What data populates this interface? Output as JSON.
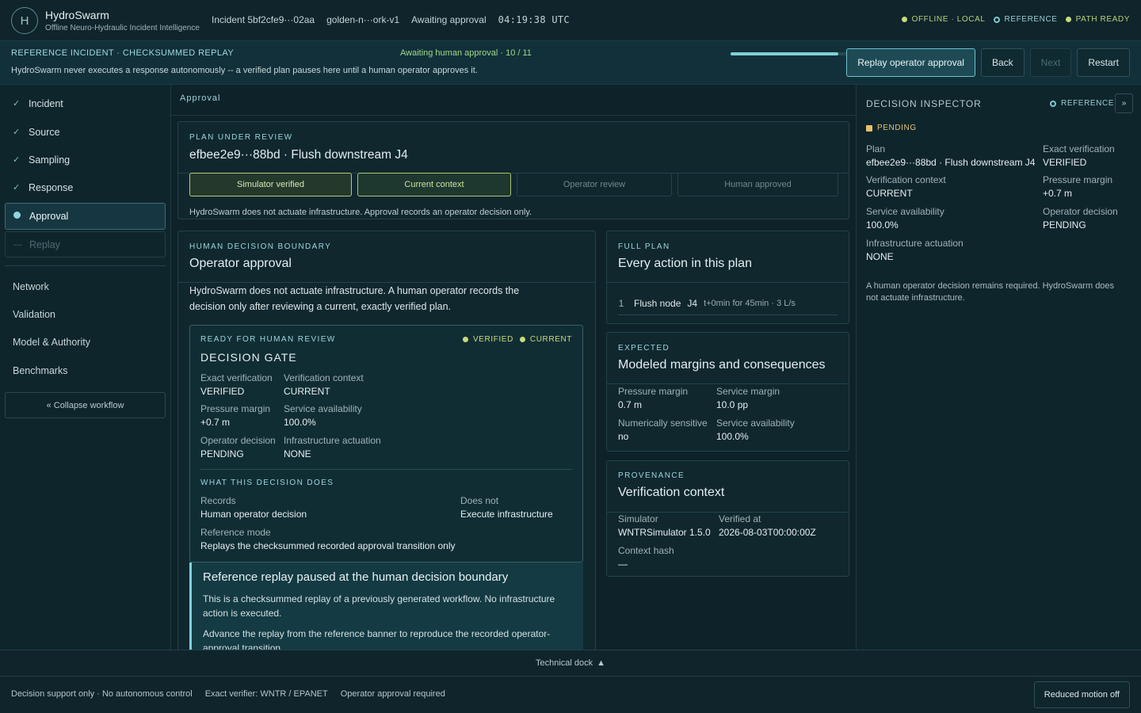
{
  "app": {
    "logo_letter": "H",
    "name": "HydroSwarm",
    "subtitle": "Offline Neuro-Hydraulic Incident Intelligence"
  },
  "topbar": {
    "incident": "Incident 5bf2cfe9···02aa",
    "network": "golden-n···ork-v1",
    "state": "Awaiting approval",
    "clock": "04:19:38 UTC",
    "status": {
      "offline": "OFFLINE · LOCAL",
      "reference": "REFERENCE",
      "path": "PATH READY"
    },
    "colors": {
      "ready": "#c7dc7c",
      "reference": "#7fc8d0"
    }
  },
  "banner": {
    "title": "REFERENCE INCIDENT · CHECKSUMMED REPLAY",
    "progress_label": "Awaiting human approval · 10 / 11",
    "progress_step": 10,
    "progress_total": 11,
    "description": "HydroSwarm never executes a response autonomously -- a verified plan pauses here until a human operator approves it.",
    "buttons": {
      "replay": "Replay operator approval",
      "back": "Back",
      "next": "Next",
      "restart": "Restart"
    }
  },
  "sidebar": {
    "steps": [
      {
        "label": "Incident",
        "state": "done"
      },
      {
        "label": "Source",
        "state": "done"
      },
      {
        "label": "Sampling",
        "state": "done"
      },
      {
        "label": "Response",
        "state": "done"
      },
      {
        "label": "Approval",
        "state": "active"
      },
      {
        "label": "Replay",
        "state": "locked"
      }
    ],
    "done_mark": "✓",
    "locked_mark": "—",
    "links": [
      "Network",
      "Validation",
      "Model & Authority",
      "Benchmarks"
    ],
    "collapse": "« Collapse workflow"
  },
  "main": {
    "breadcrumb": "Approval",
    "plan": {
      "kicker": "PLAN UNDER REVIEW",
      "title": "efbee2e9···88bd · Flush downstream J4",
      "gates": [
        {
          "label": "Simulator verified",
          "state": "ok"
        },
        {
          "label": "Current context",
          "state": "ok"
        },
        {
          "label": "Operator review",
          "state": "pending"
        },
        {
          "label": "Human approved",
          "state": "pending"
        }
      ],
      "note": "HydroSwarm does not actuate infrastructure. Approval records an operator decision only."
    },
    "approval": {
      "kicker": "HUMAN DECISION BOUNDARY",
      "title": "Operator approval",
      "intro": "HydroSwarm does not actuate infrastructure. A human operator records the decision only after reviewing a current, exactly verified plan.",
      "gate": {
        "kicker": "READY FOR HUMAN REVIEW",
        "badge_verified": "VERIFIED",
        "badge_current": "CURRENT",
        "title": "DECISION GATE",
        "fields": [
          {
            "label": "Exact verification",
            "value": "VERIFIED"
          },
          {
            "label": "Verification context",
            "value": "CURRENT"
          },
          {
            "label": "Pressure margin",
            "value": "+0.7 m"
          },
          {
            "label": "Service availability",
            "value": "100.0%"
          },
          {
            "label": "Operator decision",
            "value": "PENDING"
          },
          {
            "label": "Infrastructure actuation",
            "value": "NONE"
          }
        ],
        "does_kicker": "WHAT THIS DECISION DOES",
        "records_label": "Records",
        "records_value": "Human operator decision",
        "does_not_label": "Does not",
        "does_not_value": "Execute infrastructure",
        "mode_label": "Reference mode",
        "mode_value": "Replays the checksummed recorded approval transition only"
      },
      "notice": {
        "title": "Reference replay paused at the human decision boundary",
        "p1": "This is a checksummed replay of a previously generated workflow. No infrastructure action is executed.",
        "p2": "Advance the replay from the reference banner to reproduce the recorded operator-approval transition."
      }
    },
    "full_plan": {
      "kicker": "FULL PLAN",
      "title": "Every action in this plan",
      "actions": [
        {
          "index": "1",
          "action": "Flush node",
          "node": "J4",
          "detail": "t+0min for 45min · 3 L/s"
        }
      ]
    },
    "expected": {
      "kicker": "EXPECTED",
      "title": "Modeled margins and consequences",
      "fields": [
        {
          "label": "Pressure margin",
          "value": "0.7 m"
        },
        {
          "label": "Service margin",
          "value": "10.0 pp"
        },
        {
          "label": "Numerically sensitive",
          "value": "no"
        },
        {
          "label": "Service availability",
          "value": "100.0%"
        }
      ]
    },
    "provenance": {
      "kicker": "PROVENANCE",
      "title": "Verification context",
      "fields": [
        {
          "label": "Simulator",
          "value": "WNTRSimulator 1.5.0"
        },
        {
          "label": "Verified at",
          "value": "2026-08-03T00:00:00Z"
        },
        {
          "label": "Context hash",
          "value": "—"
        }
      ]
    }
  },
  "inspector": {
    "title": "DECISION INSPECTOR",
    "reference": "REFERENCE",
    "expand_icon": "»",
    "status": "PENDING",
    "fields": [
      {
        "label": "Plan",
        "value": "efbee2e9···88bd · Flush downstream J4"
      },
      {
        "label": "Exact verification",
        "value": "VERIFIED"
      },
      {
        "label": "Verification context",
        "value": "CURRENT"
      },
      {
        "label": "Pressure margin",
        "value": "+0.7 m"
      },
      {
        "label": "Service availability",
        "value": "100.0%"
      },
      {
        "label": "Operator decision",
        "value": "PENDING"
      },
      {
        "label": "Infrastructure actuation",
        "value": "NONE"
      }
    ],
    "note": "A human operator decision remains required. HydroSwarm does not actuate infrastructure."
  },
  "dock": {
    "label": "Technical dock",
    "icon": "▲"
  },
  "footer": {
    "items": [
      "Decision support only · No autonomous control",
      "Exact verifier: WNTR / EPANET",
      "Operator approval required"
    ],
    "motion_button": "Reduced motion off"
  }
}
